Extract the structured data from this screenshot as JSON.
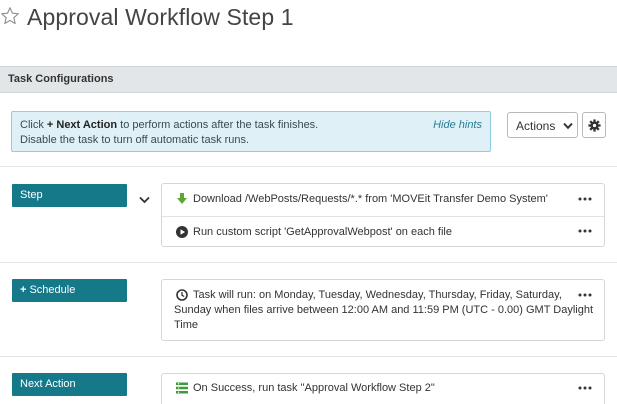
{
  "page": {
    "title": "Approval Workflow Step 1"
  },
  "section": {
    "title": "Task Configurations"
  },
  "hint": {
    "prefix": "Click ",
    "bold": "+ Next Action",
    "suffix": " to perform actions after the task finishes.",
    "line2": "Disable the task to turn off automatic task runs.",
    "hide_label": "Hide hints"
  },
  "toolbar": {
    "actions_label": "Actions"
  },
  "step": {
    "button_label": "Step",
    "rows": [
      {
        "icon": "download-arrow-icon",
        "text": "Download /WebPosts/Requests/*.* from 'MOVEit Transfer Demo System'"
      },
      {
        "icon": "play-circle-icon",
        "text": "Run custom script 'GetApprovalWebpost' on each file"
      }
    ]
  },
  "schedule": {
    "button_plus": "+",
    "button_label": "Schedule",
    "icon": "clock-icon",
    "text_line1": "Task will run: on Monday, Tuesday, Wednesday, Thursday, Friday, Saturday,",
    "text_line2": "Sunday when files arrive between 12:00 AM and 11:59 PM (UTC - 0.00) GMT Daylight",
    "text_line3": "Time"
  },
  "next_action": {
    "button_label": "Next Action",
    "icon": "list-icon",
    "text": "On Success, run task \"Approval Workflow Step 2\""
  },
  "colors": {
    "teal": "#15798a",
    "hint_bg": "#dff1f7",
    "download_green": "#5aa832",
    "list_green": "#3f9a3a"
  }
}
